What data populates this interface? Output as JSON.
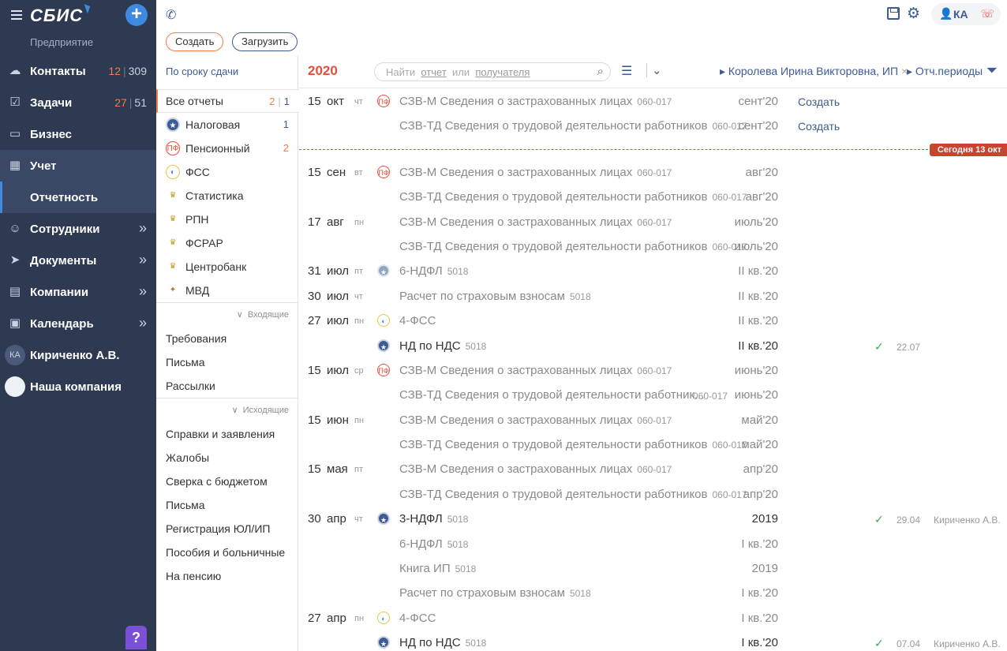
{
  "app": {
    "logo": "СБИС",
    "org": "Предприятие",
    "help": "?"
  },
  "nav": [
    {
      "label": "Контакты",
      "icon": "chat-icon",
      "hot": "12",
      "all": "309"
    },
    {
      "label": "Задачи",
      "icon": "tasks-icon",
      "hot": "27",
      "all": "51"
    },
    {
      "label": "Бизнес",
      "icon": "briefcase-icon"
    },
    {
      "label": "Учет",
      "icon": "calculator-icon"
    },
    {
      "label": "Отчетность",
      "icon": ""
    },
    {
      "label": "Сотрудники",
      "icon": "people-icon"
    },
    {
      "label": "Документы",
      "icon": "send-icon"
    },
    {
      "label": "Компании",
      "icon": "building-icon"
    },
    {
      "label": "Календарь",
      "icon": "calendar-icon",
      "cal": "13"
    },
    {
      "label": "Кириченко А.В.",
      "avatar": "КА"
    },
    {
      "label": "Наша компания"
    }
  ],
  "topbar": {
    "create": "Создать",
    "upload": "Загрузить",
    "user_initials": "КА"
  },
  "filters": {
    "deadline": "По сроку сдачи",
    "main": [
      {
        "label": "Все отчеты",
        "hot": "2",
        "all": "1"
      },
      {
        "label": "Налоговая",
        "icon": "fns-icon",
        "count": "1"
      },
      {
        "label": "Пенсионный",
        "icon": "pfr-icon",
        "count_hot": "2"
      },
      {
        "label": "ФСС",
        "icon": "fss-icon"
      },
      {
        "label": "Статистика",
        "icon": "rosstat-icon"
      },
      {
        "label": "РПН",
        "icon": "rpn-icon"
      },
      {
        "label": "ФСРАР",
        "icon": "fsrar-icon"
      },
      {
        "label": "Центробанк",
        "icon": "cb-icon"
      },
      {
        "label": "МВД",
        "icon": "mvd-icon"
      }
    ],
    "incoming_label": "Входящие",
    "incoming": [
      "Требования",
      "Письма",
      "Рассылки"
    ],
    "outgoing_label": "Исходящие",
    "outgoing": [
      "Справки и заявления",
      "Жалобы",
      "Сверка с бюджетом",
      "Письма",
      "Регистрация ЮЛ/ИП",
      "Пособия и больничные",
      "На пенсию"
    ]
  },
  "header": {
    "year": "2020",
    "search_pre": "Найти",
    "search_a": "отчет",
    "search_or": "или",
    "search_b": "получателя",
    "person_filter": "Королева Ирина Викторовна, ИП",
    "periods_filter": "Отч.периоды",
    "today_badge": "Сегодня 13 окт"
  },
  "rows": [
    {
      "day": "15",
      "mon": "окт",
      "wd": "чт",
      "icon": "pfr",
      "name": "СЗВ-М Сведения о застрахованных лицах",
      "code": "060-017",
      "period": "сент'20",
      "action": "Создать"
    },
    {
      "name": "СЗВ-ТД Сведения о трудовой деятельности работников",
      "code": "060-017",
      "period": "сент'20",
      "action": "Создать"
    },
    {
      "today": true
    },
    {
      "day": "15",
      "mon": "сен",
      "wd": "вт",
      "icon": "pfr",
      "name": "СЗВ-М Сведения о застрахованных лицах",
      "code": "060-017",
      "period": "авг'20"
    },
    {
      "name": "СЗВ-ТД Сведения о трудовой деятельности работников",
      "code": "060-017",
      "period": "авг'20"
    },
    {
      "day": "17",
      "mon": "авг",
      "wd": "пн",
      "name": "СЗВ-М Сведения о застрахованных лицах",
      "code": "060-017",
      "period": "июль'20"
    },
    {
      "name": "СЗВ-ТД Сведения о трудовой деятельности работников",
      "code": "060-017",
      "period": "июль'20"
    },
    {
      "day": "31",
      "mon": "июл",
      "wd": "пт",
      "icon": "fns-light",
      "name": "6-НДФЛ",
      "code": "5018",
      "period": "II кв.'20"
    },
    {
      "day": "30",
      "mon": "июл",
      "wd": "чт",
      "name": "Расчет по страховым взносам",
      "code": "5018",
      "period": "II кв.'20"
    },
    {
      "day": "27",
      "mon": "июл",
      "wd": "пн",
      "icon": "fss",
      "name": "4-ФСС",
      "period": "II кв.'20"
    },
    {
      "icon": "fns",
      "name": "НД по НДС",
      "code": "5018",
      "period": "II кв.'20",
      "dark": true,
      "check": "✓",
      "date2": "22.07"
    },
    {
      "day": "15",
      "mon": "июл",
      "wd": "ср",
      "icon": "pfr",
      "name": "СЗВ-М Сведения о застрахованных лицах",
      "code": "060-017",
      "period": "июнь'20"
    },
    {
      "name": "СЗВ-ТД Сведения о трудовой деятельности работник...",
      "code2": "060-017",
      "period": "июнь'20"
    },
    {
      "day": "15",
      "mon": "июн",
      "wd": "пн",
      "name": "СЗВ-М Сведения о застрахованных лицах",
      "code": "060-017",
      "period": "май'20"
    },
    {
      "name": "СЗВ-ТД Сведения о трудовой деятельности работников",
      "code": "060-017",
      "period": "май'20"
    },
    {
      "day": "15",
      "mon": "мая",
      "wd": "пт",
      "name": "СЗВ-М Сведения о застрахованных лицах",
      "code": "060-017",
      "period": "апр'20"
    },
    {
      "name": "СЗВ-ТД Сведения о трудовой деятельности работников",
      "code": "060-017",
      "period": "апр'20"
    },
    {
      "day": "30",
      "mon": "апр",
      "wd": "чт",
      "icon": "fns",
      "name": "3-НДФЛ",
      "code": "5018",
      "period": "2019",
      "dark": true,
      "check": "✓",
      "date2": "29.04",
      "who": "Кириченко А.В."
    },
    {
      "name": "6-НДФЛ",
      "code": "5018",
      "period": "I кв.'20"
    },
    {
      "name": "Книга ИП",
      "code": "5018",
      "period": "2019"
    },
    {
      "name": "Расчет по страховым взносам",
      "code": "5018",
      "period": "I кв.'20"
    },
    {
      "day": "27",
      "mon": "апр",
      "wd": "пн",
      "icon": "fss",
      "name": "4-ФСС",
      "period": "I кв.'20"
    },
    {
      "icon": "fns",
      "name": "НД по НДС",
      "code": "5018",
      "period": "I кв.'20",
      "dark": true,
      "check": "✓",
      "date2": "07.04",
      "who": "Кириченко А.В."
    }
  ]
}
